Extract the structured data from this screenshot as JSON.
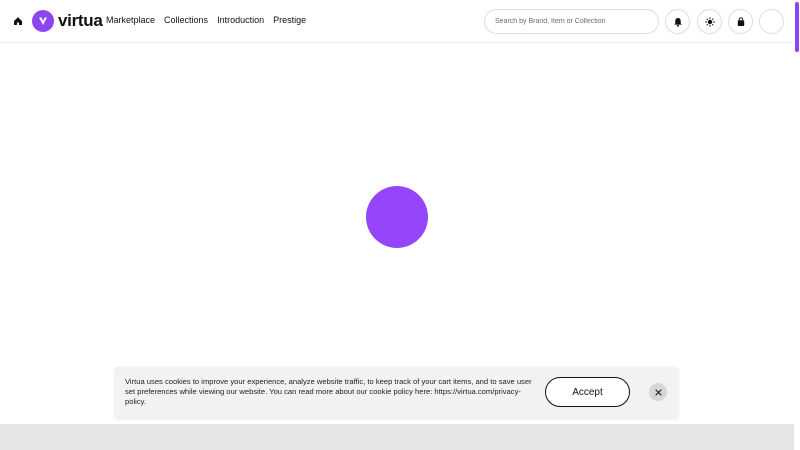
{
  "brand": {
    "name": "virtua",
    "accent_color": "#8b45f5"
  },
  "header": {
    "home_icon": "home-icon",
    "nav": [
      {
        "label": "Marketplace"
      },
      {
        "label": "Collections"
      },
      {
        "label": "Introduction"
      },
      {
        "label": "Prestige"
      }
    ],
    "search": {
      "placeholder": "Search by Brand, Item or Collection",
      "value": ""
    },
    "icons": [
      "bell-icon",
      "theme-toggle-icon",
      "bag-icon",
      "avatar"
    ]
  },
  "main": {
    "loading_indicator_color": "#9546fb"
  },
  "cookie_banner": {
    "text": "Virtua uses cookies to improve your experience, analyze website traffic, to keep track of your cart items, and to save user set preferences while viewing our website. You can read more about our cookie policy here: https://virtua.com/privacy-policy.",
    "accept_label": "Accept",
    "close_icon": "close-icon"
  }
}
